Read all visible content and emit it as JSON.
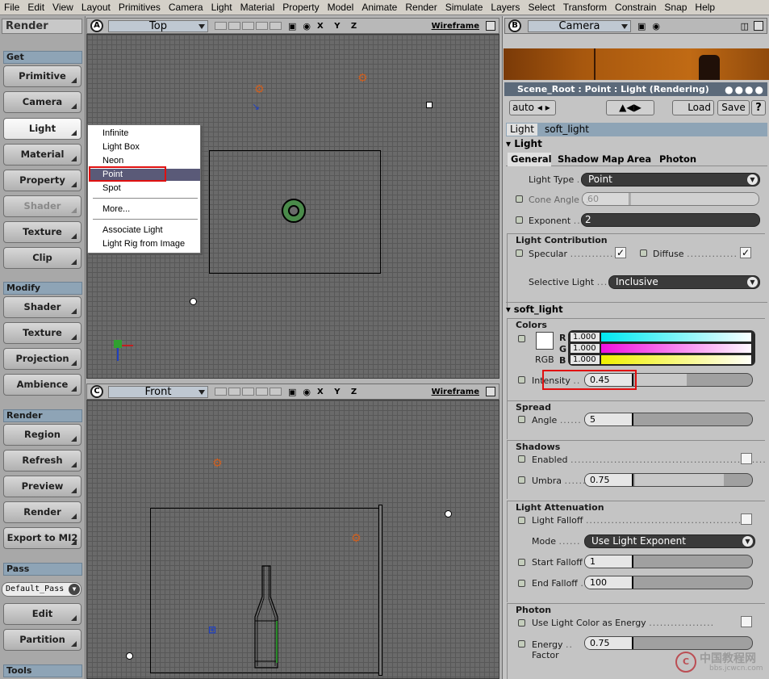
{
  "menu": [
    "File",
    "Edit",
    "View",
    "Layout",
    "Primitives",
    "Camera",
    "Light",
    "Material",
    "Property",
    "Model",
    "Animate",
    "Render",
    "Simulate",
    "Layers",
    "Select",
    "Transform",
    "Constrain",
    "Snap",
    "Help"
  ],
  "toolbar": {
    "title": "Render",
    "get_label": "Get",
    "get_buttons": [
      "Primitive",
      "Camera",
      "Light",
      "Material",
      "Property",
      "Shader",
      "Texture",
      "Clip"
    ],
    "modify_label": "Modify",
    "modify_buttons": [
      "Shader",
      "Texture",
      "Projection",
      "Ambience"
    ],
    "render_label": "Render",
    "render_buttons": [
      "Region",
      "Refresh",
      "Preview",
      "Render",
      "Export to MI2"
    ],
    "pass_label": "Pass",
    "pass_select": "Default_Pass",
    "pass_buttons": [
      "Edit",
      "Partition"
    ],
    "tools_label": "Tools"
  },
  "viewport_a": {
    "letter": "A",
    "view": "Top",
    "axes": "X Y Z",
    "mode": "Wireframe"
  },
  "viewport_b": {
    "letter": "B",
    "view": "Camera"
  },
  "viewport_c": {
    "letter": "C",
    "view": "Front",
    "axes": "X Y Z",
    "mode": "Wireframe"
  },
  "light_menu": {
    "items": [
      "Infinite",
      "Light Box",
      "Neon",
      "Point",
      "Spot"
    ],
    "more": "More...",
    "extra": [
      "Associate Light",
      "Light Rig from Image"
    ],
    "highlighted": "Point"
  },
  "ppg": {
    "title": "Scene_Root : Point : Light (Rendering)",
    "auto": "auto",
    "load": "Load",
    "save": "Save",
    "help": "?",
    "tab_light": "Light",
    "tab_soft": "soft_light",
    "light_header": "Light",
    "subtabs": [
      "General",
      "Shadow Map",
      "Area",
      "Photon"
    ],
    "light_type_label": "Light Type",
    "light_type": "Point",
    "cone_angle_label": "Cone Angle",
    "cone_angle": "60",
    "exponent_label": "Exponent",
    "exponent": "2",
    "contribution_title": "Light Contribution",
    "specular_label": "Specular",
    "diffuse_label": "Diffuse",
    "selective_label": "Selective Light",
    "selective": "Inclusive",
    "soft_header": "soft_light",
    "colors_title": "Colors",
    "r_label": "R",
    "g_label": "G",
    "b_label": "B",
    "r": "1.000",
    "g": "1.000",
    "b": "1.000",
    "rgb_label": "RGB",
    "intensity_label": "Intensity",
    "intensity": "0.45",
    "spread_title": "Spread",
    "angle_label": "Angle",
    "angle": "5",
    "shadows_title": "Shadows",
    "enabled_label": "Enabled",
    "umbra_label": "Umbra",
    "umbra": "0.75",
    "atten_title": "Light Attenuation",
    "falloff_label": "Light Falloff",
    "mode_label": "Mode",
    "mode": "Use Light Exponent",
    "start_label": "Start Falloff",
    "start": "1",
    "end_label": "End Falloff",
    "end": "100",
    "photon_title": "Photon",
    "use_color_label": "Use Light Color as Energy",
    "energy_label": "Energy",
    "energy_label2": "Factor",
    "energy": "0.75"
  },
  "watermark": {
    "title": "中国教程网",
    "url": "bbs.jcwcn.com"
  },
  "colors": {
    "accent_red": "#e01010",
    "section_blue": "#8ea4b6",
    "highlight": "#5a5a78"
  }
}
